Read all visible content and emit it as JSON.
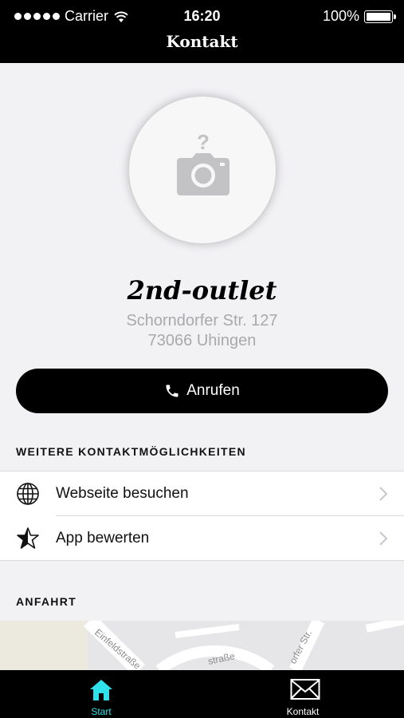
{
  "status_bar": {
    "carrier": "Carrier",
    "time": "16:20",
    "battery": "100%"
  },
  "nav": {
    "title": "Kontakt"
  },
  "profile": {
    "name": "2nd-outlet",
    "street": "Schorndorfer Str. 127",
    "city": "73066 Uhingen",
    "photo_icon": "camera-question-icon"
  },
  "call_button": {
    "label": "Anrufen",
    "icon": "phone-icon"
  },
  "contact_section": {
    "title": "WEITERE KONTAKTMÖGLICHKEITEN",
    "items": [
      {
        "label": "Webseite besuchen",
        "icon": "globe-icon"
      },
      {
        "label": "App bewerten",
        "icon": "star-icon"
      }
    ]
  },
  "directions_section": {
    "title": "ANFAHRT",
    "map_labels": [
      "Einfeldstraße",
      "straße",
      "orfer Str."
    ]
  },
  "tab_bar": {
    "tabs": [
      {
        "label": "Start",
        "icon": "home-icon",
        "active": true
      },
      {
        "label": "Kontakt",
        "icon": "envelope-icon",
        "active": false
      }
    ]
  },
  "colors": {
    "accent": "#2fe1e8",
    "bar": "#000000",
    "background": "#f2f1f4"
  }
}
